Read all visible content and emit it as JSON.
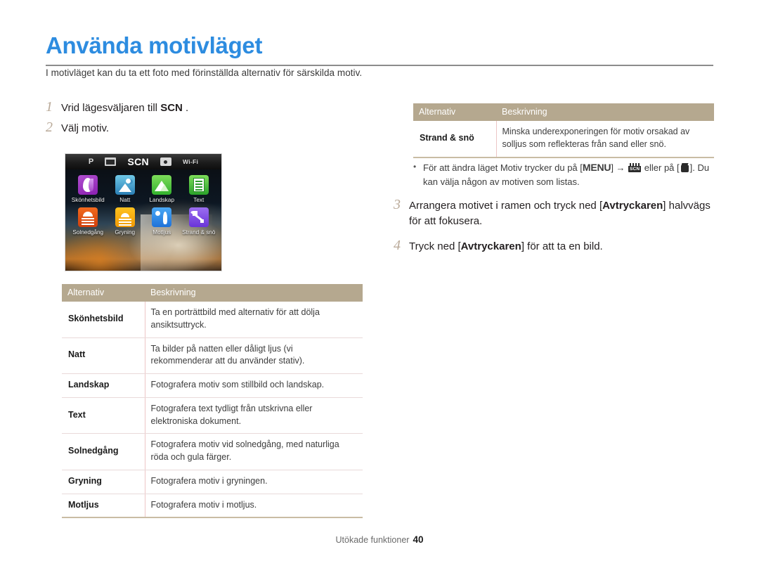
{
  "document": {
    "title": "Använda motivläget",
    "intro": "I motivläget kan du ta ett foto med förinställda alternativ för särskilda motiv.",
    "accent_color": "#2d8ce0",
    "table_header_color": "#b5a88f"
  },
  "steps": {
    "step1": {
      "num": "1",
      "text_before": "Vrid lägesväljaren till ",
      "bold": "SCN",
      "text_after": " ."
    },
    "step2": {
      "num": "2",
      "text": "Välj motiv."
    },
    "step3": {
      "num": "3",
      "before": "Arrangera motivet i ramen och tryck ned [",
      "bold": "Avtryckaren",
      "after": "] halvvägs för att fokusera."
    },
    "step4": {
      "num": "4",
      "before": "Tryck ned [",
      "bold": "Avtryckaren",
      "after": "] för att ta en bild."
    }
  },
  "camera_screen": {
    "topbar": {
      "mode_p": "P",
      "icon_movie": "movie-camera-icon",
      "mode_scn": "SCN",
      "icon_camera": "camera-icon",
      "wifi": "Wi-Fi"
    },
    "scenes": [
      {
        "label": "Skönhetsbild",
        "icon": "beauty-shot-icon"
      },
      {
        "label": "Natt",
        "icon": "night-icon"
      },
      {
        "label": "Landskap",
        "icon": "landscape-icon"
      },
      {
        "label": "Text",
        "icon": "text-icon"
      },
      {
        "label": "Solnedgång",
        "icon": "sunset-icon"
      },
      {
        "label": "Gryning",
        "icon": "dawn-icon"
      },
      {
        "label": "Motljus",
        "icon": "backlight-icon"
      },
      {
        "label": "Strand & snö",
        "icon": "beach-snow-icon"
      }
    ]
  },
  "table_left": {
    "headers": [
      "Alternativ",
      "Beskrivning"
    ],
    "rows": [
      [
        "Skönhetsbild",
        "Ta en porträttbild med alternativ för att dölja ansiktsuttryck."
      ],
      [
        "Natt",
        "Ta bilder på natten eller dåligt ljus (vi rekommenderar att du använder stativ)."
      ],
      [
        "Landskap",
        "Fotografera motiv som stillbild och landskap."
      ],
      [
        "Text",
        "Fotografera text tydligt från utskrivna eller elektroniska dokument."
      ],
      [
        "Solnedgång",
        "Fotografera motiv vid solnedgång, med naturliga röda och gula färger."
      ],
      [
        "Gryning",
        "Fotografera motiv i gryningen."
      ],
      [
        "Motljus",
        "Fotografera motiv i motljus."
      ]
    ]
  },
  "table_right": {
    "headers": [
      "Alternativ",
      "Beskrivning"
    ],
    "rows": [
      [
        "Strand & snö",
        "Minska underexponeringen för motiv orsakad av solljus som reflekteras från sand eller snö."
      ]
    ]
  },
  "note": {
    "bullet": "•",
    "part1": "För att ändra läget Motiv trycker du på [",
    "menu": "MENU",
    "part2": "] → ",
    "scn_icon_label": "SCN",
    "part3": " eller på [",
    "part4": "]. Du kan välja någon av motiven som listas."
  },
  "footer": {
    "label": "Utökade funktioner",
    "page": "40"
  }
}
